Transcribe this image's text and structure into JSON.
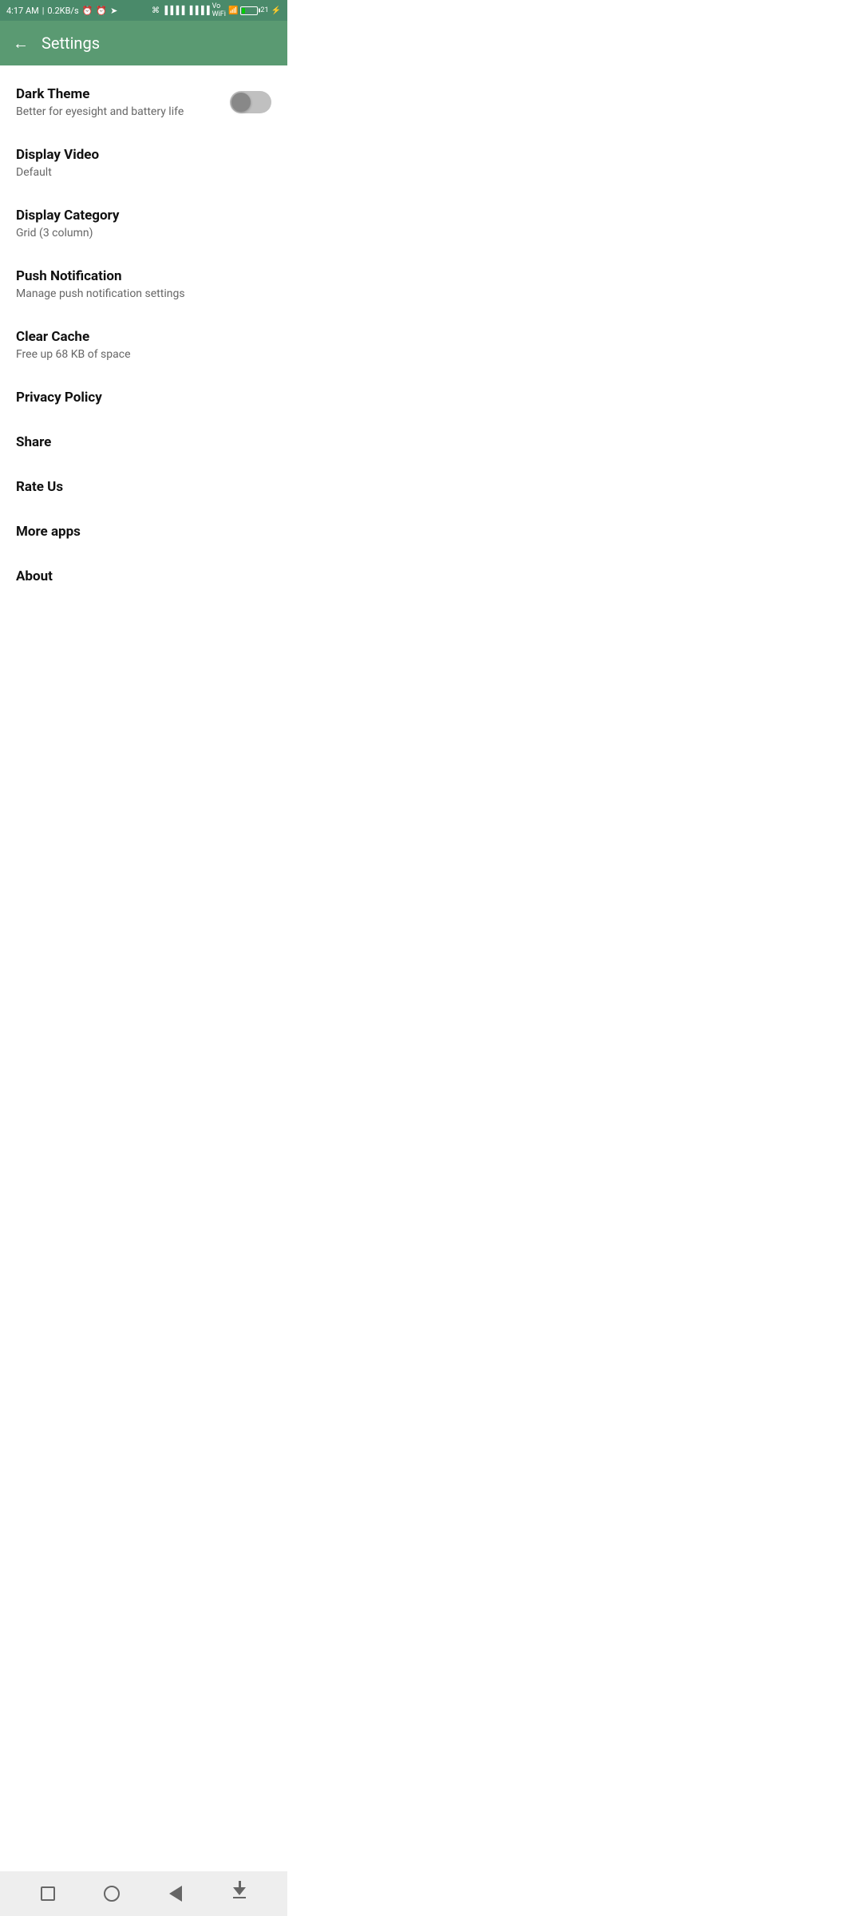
{
  "statusBar": {
    "time": "4:17 AM",
    "speed": "0.2KB/s"
  },
  "appBar": {
    "title": "Settings",
    "backLabel": "←"
  },
  "settings": {
    "items": [
      {
        "id": "dark-theme",
        "title": "Dark Theme",
        "subtitle": "Better for eyesight and battery life",
        "type": "toggle",
        "toggleState": false
      },
      {
        "id": "display-video",
        "title": "Display Video",
        "subtitle": "Default",
        "type": "value"
      },
      {
        "id": "display-category",
        "title": "Display Category",
        "subtitle": "Grid (3 column)",
        "type": "value"
      },
      {
        "id": "push-notification",
        "title": "Push Notification",
        "subtitle": "Manage push notification settings",
        "type": "value"
      },
      {
        "id": "clear-cache",
        "title": "Clear Cache",
        "subtitle": "Free up 68 KB of space",
        "type": "value"
      },
      {
        "id": "privacy-policy",
        "title": "Privacy Policy",
        "subtitle": null,
        "type": "link"
      },
      {
        "id": "share",
        "title": "Share",
        "subtitle": null,
        "type": "link"
      },
      {
        "id": "rate-us",
        "title": "Rate Us",
        "subtitle": null,
        "type": "link"
      },
      {
        "id": "more-apps",
        "title": "More apps",
        "subtitle": null,
        "type": "link"
      },
      {
        "id": "about",
        "title": "About",
        "subtitle": null,
        "type": "link"
      }
    ]
  },
  "navBar": {
    "recents": "recents",
    "home": "home",
    "back": "back",
    "download": "download"
  }
}
